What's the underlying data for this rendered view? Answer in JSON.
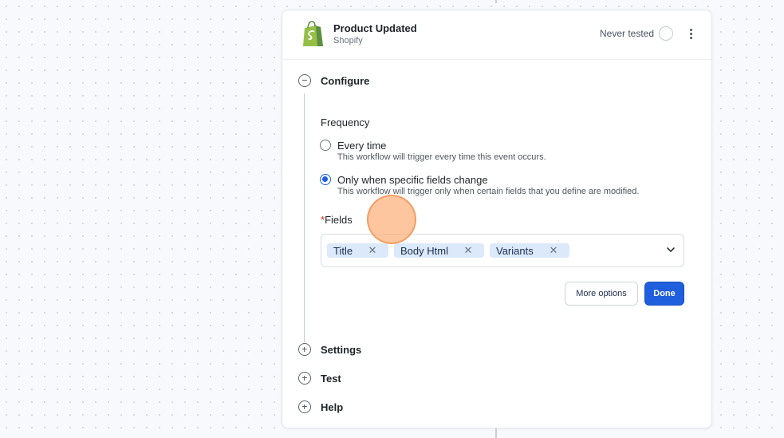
{
  "header": {
    "title": "Product Updated",
    "app": "Shopify",
    "status": "Never tested"
  },
  "sections": {
    "configure": "Configure",
    "settings": "Settings",
    "test": "Test",
    "help": "Help"
  },
  "configure": {
    "frequency_label": "Frequency",
    "options": [
      {
        "title": "Every time",
        "description": "This workflow will trigger every time this event occurs.",
        "selected": false
      },
      {
        "title": "Only when specific fields change",
        "description": "This workflow will trigger only when certain fields that you define are modified.",
        "selected": true
      }
    ],
    "fields_required_mark": "*",
    "fields_label": "Fields",
    "fields": [
      "Title",
      "Body Html",
      "Variants"
    ],
    "more_options_label": "More options",
    "done_label": "Done"
  },
  "colors": {
    "accent": "#1f5fde",
    "chip": "#dbe9fb",
    "shopify_green": "#95bf47",
    "cursor_highlight": "#fcb078"
  },
  "icons": {
    "app_logo": "shopify-bag-icon",
    "status": "status-circle-icon",
    "menu": "more-vertical-icon",
    "collapse": "minus-circle-icon",
    "expand": "plus-circle-icon",
    "remove": "close-icon",
    "dropdown": "chevron-down-icon"
  }
}
